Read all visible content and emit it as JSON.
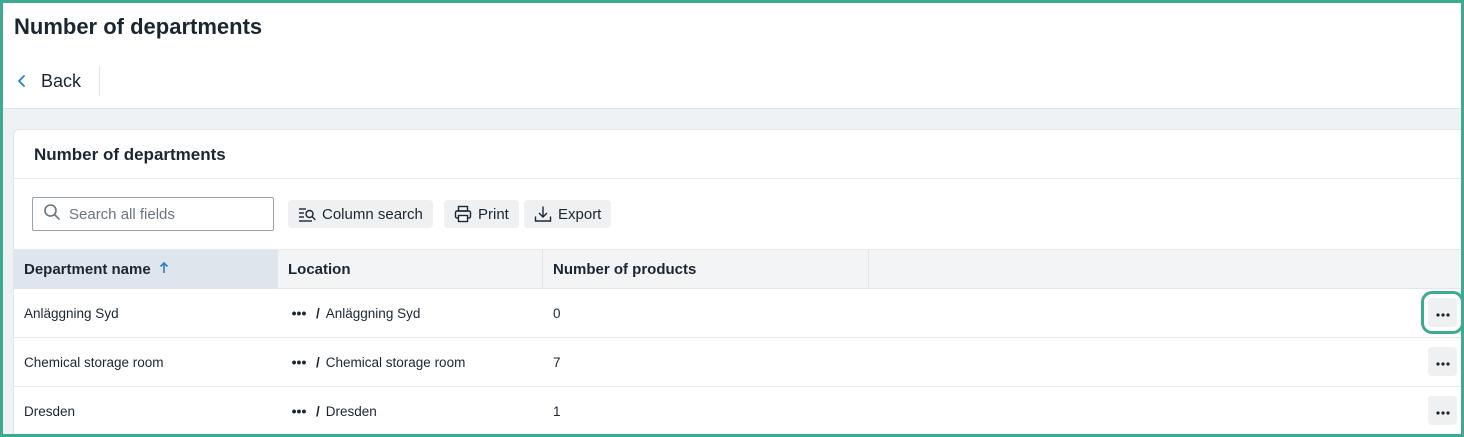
{
  "page": {
    "title": "Number of departments",
    "back_label": "Back"
  },
  "card": {
    "title": "Number of departments"
  },
  "toolbar": {
    "search_placeholder": "Search all fields",
    "column_search_label": "Column search",
    "print_label": "Print",
    "export_label": "Export"
  },
  "table": {
    "columns": [
      "Department name",
      "Location",
      "Number of products"
    ],
    "sorted_column": "Department name",
    "sort_direction": "ascending",
    "rows": [
      {
        "department": "Anläggning Syd",
        "location_more": "•••",
        "location_sep": "/",
        "location": "Anläggning Syd",
        "products": "0"
      },
      {
        "department": "Chemical storage room",
        "location_more": "•••",
        "location_sep": "/",
        "location": "Chemical storage room",
        "products": "7"
      },
      {
        "department": "Dresden",
        "location_more": "•••",
        "location_sep": "/",
        "location": "Dresden",
        "products": "1"
      }
    ]
  },
  "colors": {
    "accent_highlight": "#3dab92",
    "sort_arrow": "#2a7fc1",
    "header_bg": "#f2f4f6",
    "sorted_header_bg": "#dfe5ec"
  },
  "icons": {
    "back": "chevron-left-icon",
    "search": "search-icon",
    "column_search": "column-search-icon",
    "print": "printer-icon",
    "export": "download-icon",
    "sort": "arrow-up-icon",
    "row_menu": "more-horizontal-icon"
  }
}
